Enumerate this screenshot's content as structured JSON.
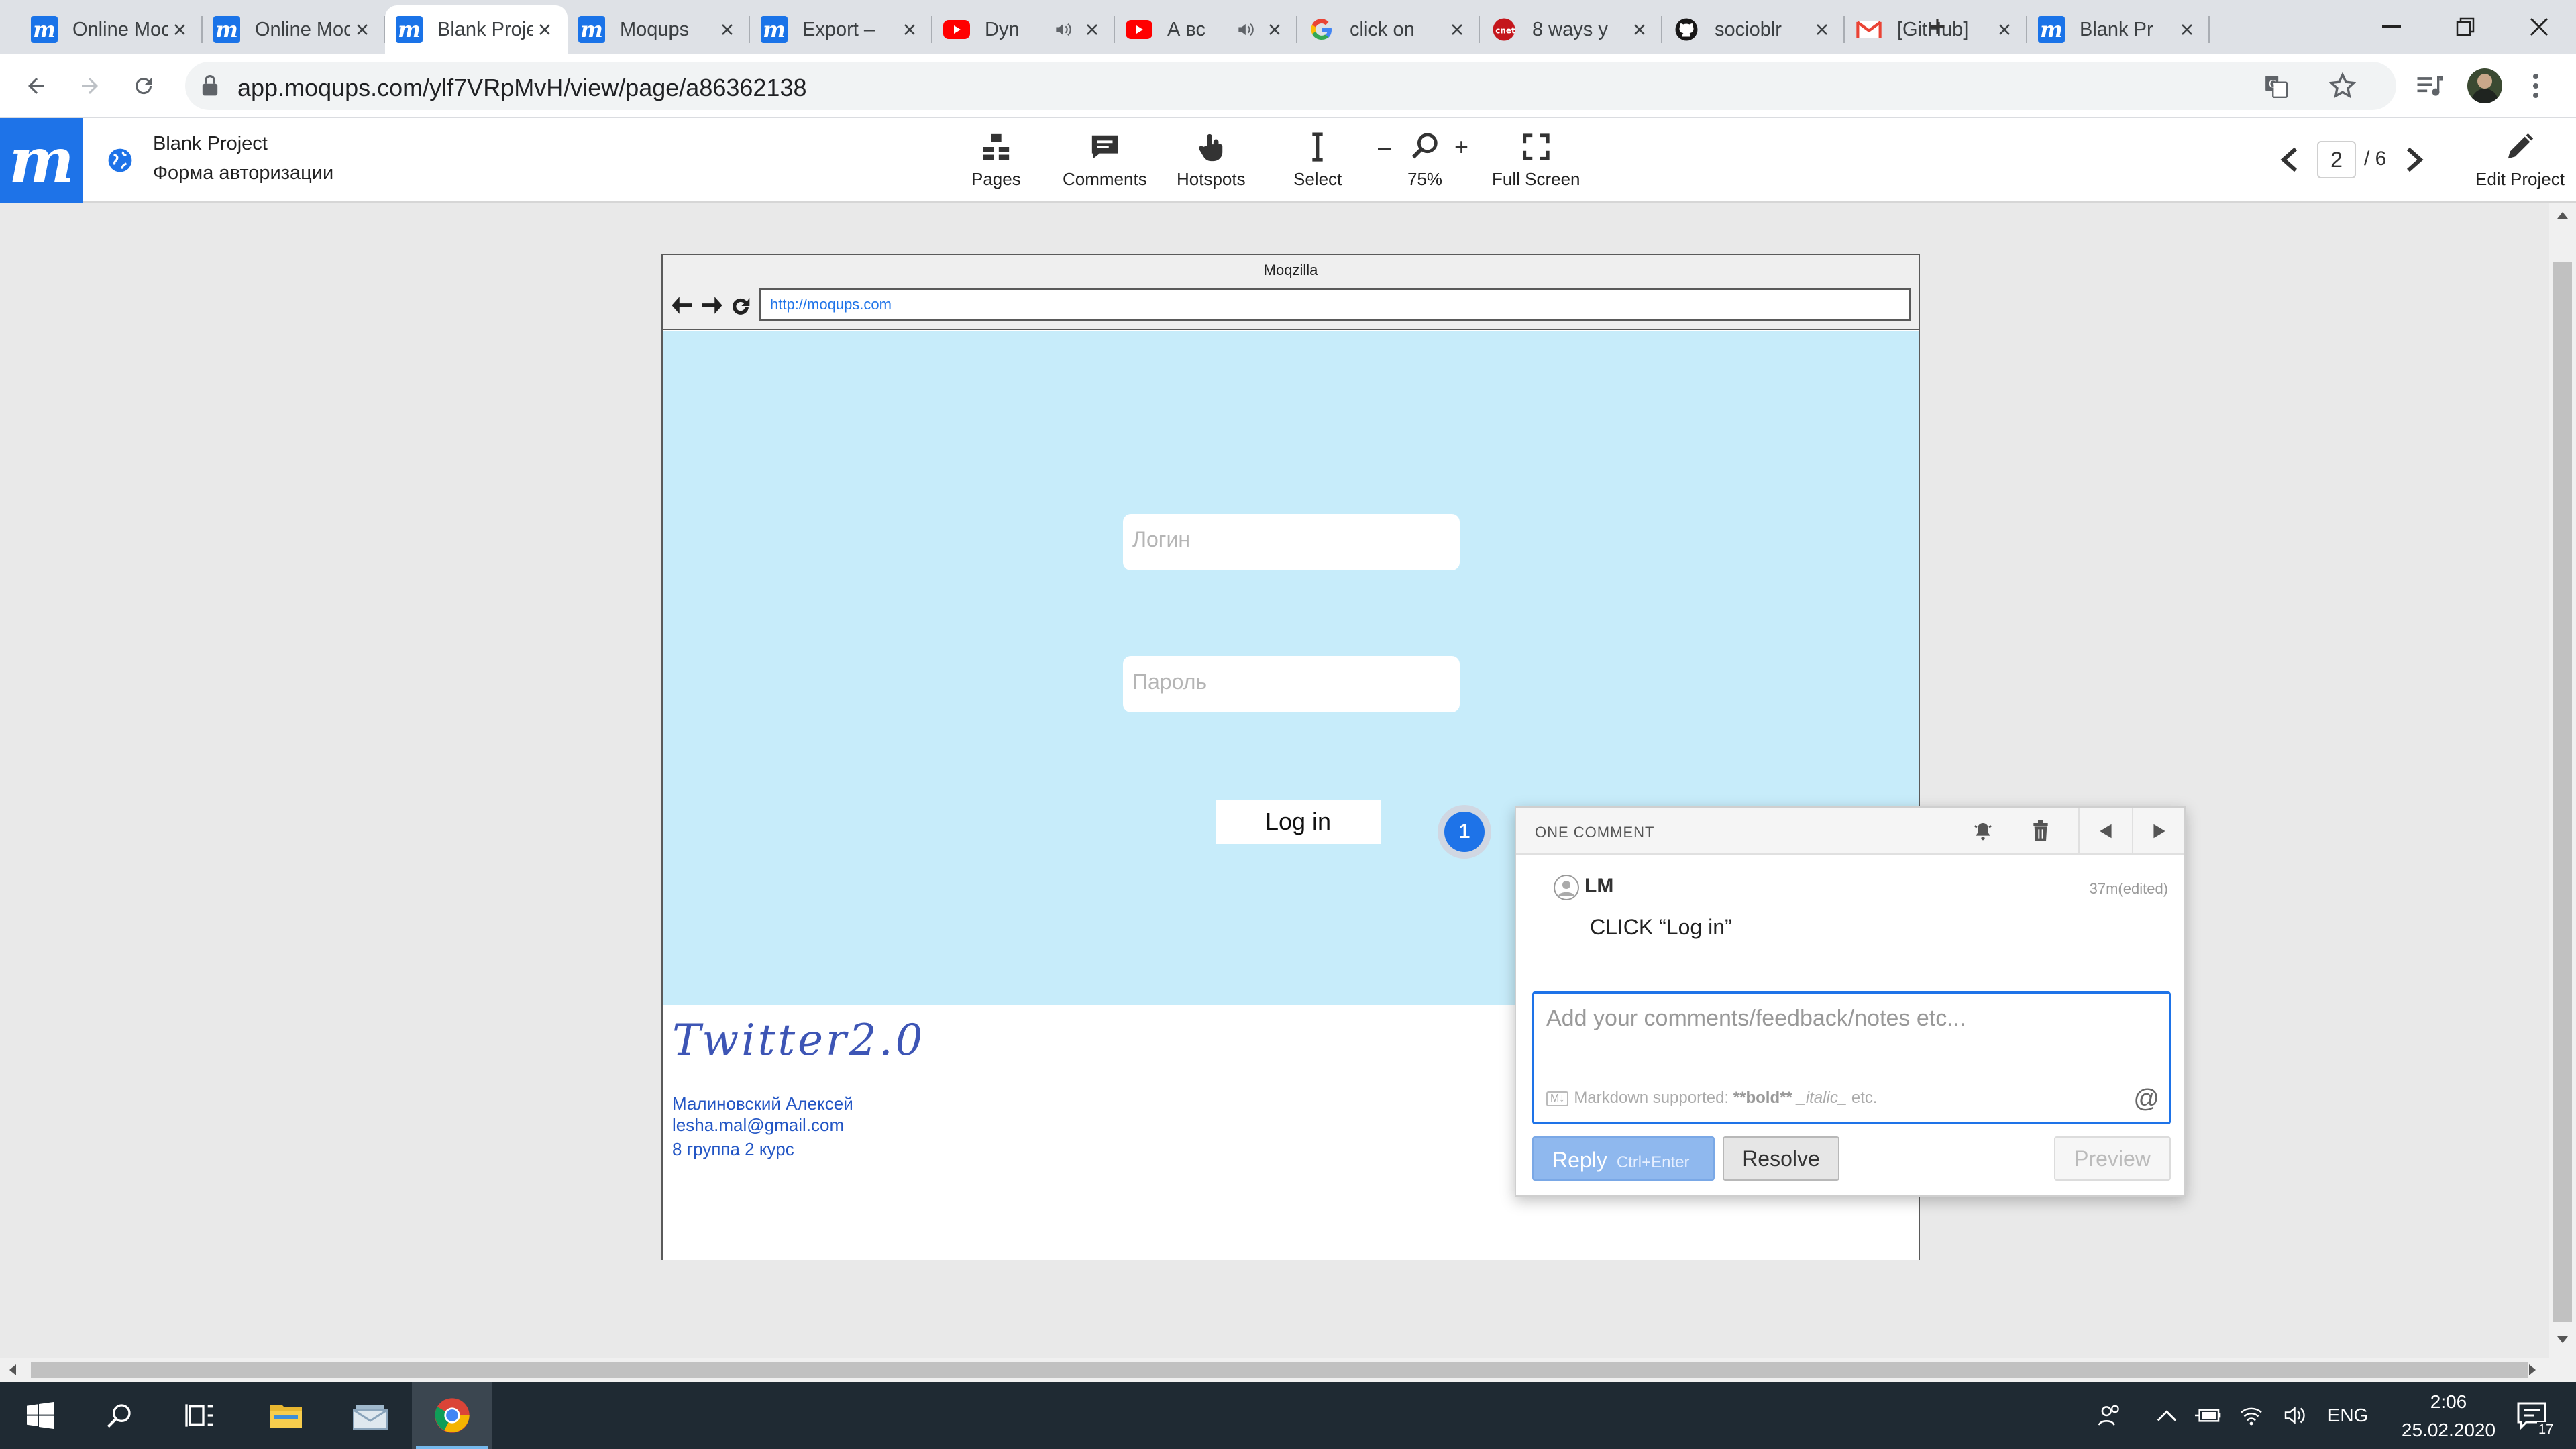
{
  "browser": {
    "tabs": [
      {
        "title": "Online Mockup",
        "favicon": "moqups-icon",
        "active": false,
        "sound": false
      },
      {
        "title": "Online Mockup",
        "favicon": "moqups-icon",
        "active": false,
        "sound": false
      },
      {
        "title": "Blank Project",
        "favicon": "moqups-icon",
        "active": true,
        "sound": false
      },
      {
        "title": "Moqups",
        "favicon": "moqups-icon",
        "active": false,
        "sound": false
      },
      {
        "title": "Export –",
        "favicon": "moqups-icon",
        "active": false,
        "sound": false
      },
      {
        "title": "Dyn",
        "favicon": "youtube-icon",
        "active": false,
        "sound": true
      },
      {
        "title": "А вс",
        "favicon": "youtube-icon",
        "active": false,
        "sound": true
      },
      {
        "title": "click on",
        "favicon": "google-icon",
        "active": false,
        "sound": false
      },
      {
        "title": "8 ways y",
        "favicon": "cnet-icon",
        "active": false,
        "sound": false
      },
      {
        "title": "socioblr",
        "favicon": "github-icon",
        "active": false,
        "sound": false
      },
      {
        "title": "[GitHub]",
        "favicon": "gmail-icon",
        "active": false,
        "sound": false
      },
      {
        "title": "Blank Pr",
        "favicon": "moqups-icon",
        "active": false,
        "sound": false
      }
    ],
    "new_tab": "+",
    "url": "app.moqups.com/ylf7VRpMvH/view/page/a86362138"
  },
  "app": {
    "logo": "m",
    "project_title": "Blank Project",
    "page_name": "Форма авторизации",
    "tools": {
      "pages": "Pages",
      "comments": "Comments",
      "hotspots": "Hotspots",
      "select": "Select",
      "zoom": "75%",
      "zoom_minus": "–",
      "zoom_plus": "+",
      "fullscreen": "Full Screen"
    },
    "pager": {
      "current": "2",
      "total": "/ 6"
    },
    "edit_project": "Edit Project"
  },
  "mockup": {
    "browser_title": "Moqzilla",
    "browser_url": "http://moqups.com",
    "login_placeholder": "Логин",
    "password_placeholder": "Пароль",
    "login_button": "Log in",
    "footer": {
      "logo": "Twitter2.0",
      "author": "Малиновский Алексей",
      "email": "lesha.mal@gmail.com",
      "group": "8 группа 2 курс"
    }
  },
  "comment": {
    "marker": "1",
    "header": "ONE COMMENT",
    "author": "LM",
    "time": "37m(edited)",
    "text": "CLICK “Log in”",
    "input_placeholder": "Add your comments/feedback/notes etc...",
    "markdown_hint": "Markdown supported:",
    "markdown_bold": "**bold**",
    "markdown_italic": "_italic_",
    "markdown_etc": "etc.",
    "at_symbol": "@",
    "reply": "Reply",
    "reply_shortcut": "Ctrl+Enter",
    "resolve": "Resolve",
    "preview": "Preview"
  },
  "taskbar": {
    "language": "ENG",
    "time": "2:06",
    "date": "25.02.2020",
    "notifications": "17"
  },
  "colors": {
    "accent": "#1e73e8",
    "mockup_background": "#c7ecfa",
    "taskbar": "#1f2a33"
  }
}
